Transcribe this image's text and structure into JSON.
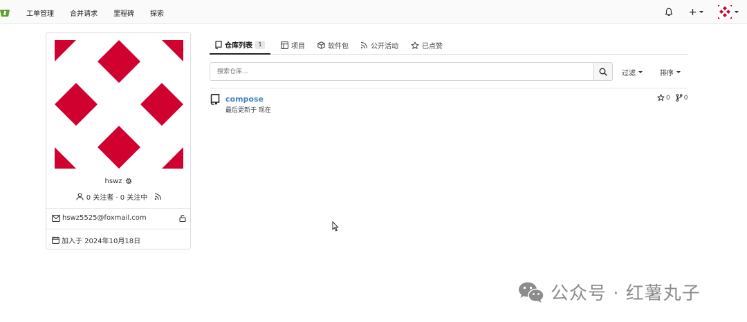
{
  "nav": {
    "items": [
      "工单管理",
      "合并请求",
      "里程碑",
      "探索"
    ]
  },
  "profile": {
    "username": "hswz",
    "followers_text": "0 关注者 · 0 关注中",
    "email": "hswz5525@foxmail.com",
    "joined": "加入于 2024年10月18日",
    "avatar_color": "#d0002f"
  },
  "tabs": [
    {
      "label": "仓库列表",
      "count": "1",
      "icon": "repo-icon"
    },
    {
      "label": "项目",
      "icon": "project-icon"
    },
    {
      "label": "软件包",
      "icon": "package-icon"
    },
    {
      "label": "公开活动",
      "icon": "rss-icon"
    },
    {
      "label": "已点赞",
      "icon": "star-icon"
    }
  ],
  "search": {
    "placeholder": "搜索仓库..."
  },
  "filters": {
    "filter_label": "过滤",
    "sort_label": "排序"
  },
  "repos": [
    {
      "name": "compose",
      "updated": "最后更新于 现在",
      "stars": "0",
      "forks": "0"
    }
  ],
  "watermark": {
    "text": "公众号 · 红薯丸子"
  },
  "colors": {
    "link": "#4183c4",
    "accent": "#d0002f",
    "logo": "#5aa02c"
  }
}
